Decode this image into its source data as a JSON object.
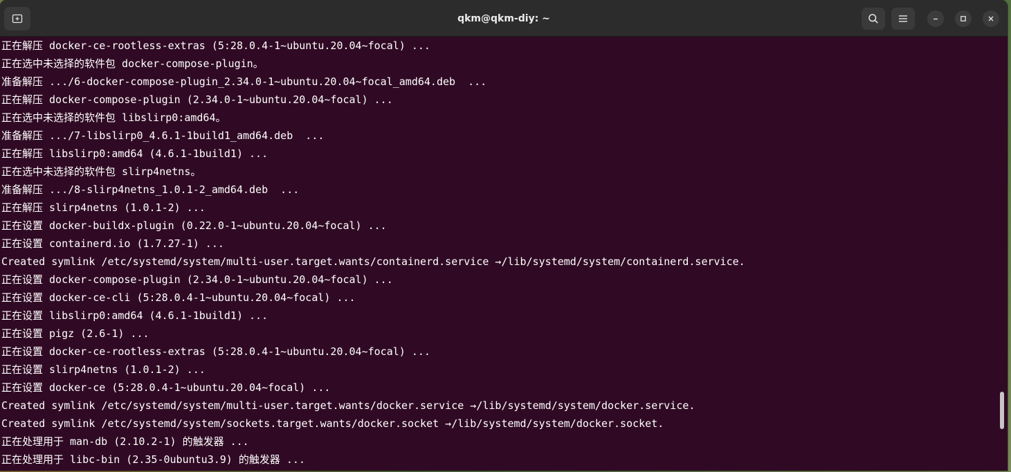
{
  "window": {
    "title": "qkm@qkm-diy: ~"
  },
  "titlebar": {
    "icons": [
      "new-tab-icon",
      "search-icon",
      "hamburger-menu-icon",
      "minimize-icon",
      "maximize-icon",
      "close-icon"
    ]
  },
  "colors": {
    "terminal_background": "#300a24",
    "terminal_foreground": "#ffffff",
    "titlebar_background": "#2c2c2c"
  },
  "terminal": {
    "lines": [
      "正在解压 docker-ce-rootless-extras (5:28.0.4-1~ubuntu.20.04~focal) ...",
      "正在选中未选择的软件包 docker-compose-plugin。",
      "准备解压 .../6-docker-compose-plugin_2.34.0-1~ubuntu.20.04~focal_amd64.deb  ...",
      "正在解压 docker-compose-plugin (2.34.0-1~ubuntu.20.04~focal) ...",
      "正在选中未选择的软件包 libslirp0:amd64。",
      "准备解压 .../7-libslirp0_4.6.1-1build1_amd64.deb  ...",
      "正在解压 libslirp0:amd64 (4.6.1-1build1) ...",
      "正在选中未选择的软件包 slirp4netns。",
      "准备解压 .../8-slirp4netns_1.0.1-2_amd64.deb  ...",
      "正在解压 slirp4netns (1.0.1-2) ...",
      "正在设置 docker-buildx-plugin (0.22.0-1~ubuntu.20.04~focal) ...",
      "正在设置 containerd.io (1.7.27-1) ...",
      "Created symlink /etc/systemd/system/multi-user.target.wants/containerd.service →/lib/systemd/system/containerd.service.",
      "正在设置 docker-compose-plugin (2.34.0-1~ubuntu.20.04~focal) ...",
      "正在设置 docker-ce-cli (5:28.0.4-1~ubuntu.20.04~focal) ...",
      "正在设置 libslirp0:amd64 (4.6.1-1build1) ...",
      "正在设置 pigz (2.6-1) ...",
      "正在设置 docker-ce-rootless-extras (5:28.0.4-1~ubuntu.20.04~focal) ...",
      "正在设置 slirp4netns (1.0.1-2) ...",
      "正在设置 docker-ce (5:28.0.4-1~ubuntu.20.04~focal) ...",
      "Created symlink /etc/systemd/system/multi-user.target.wants/docker.service →/lib/systemd/system/docker.service.",
      "Created symlink /etc/systemd/system/sockets.target.wants/docker.socket →/lib/systemd/system/docker.socket.",
      "正在处理用于 man-db (2.10.2-1) 的触发器 ...",
      "正在处理用于 libc-bin (2.35-0ubuntu3.9) 的触发器 ..."
    ]
  }
}
